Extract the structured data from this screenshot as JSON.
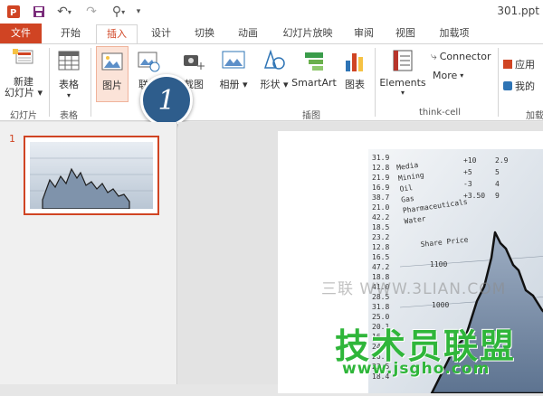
{
  "window": {
    "title": "301.ppt"
  },
  "tabs": [
    "文件",
    "开始",
    "插入",
    "设计",
    "切换",
    "动画",
    "幻灯片放映",
    "审阅",
    "视图",
    "加载项"
  ],
  "active_tab": "插入",
  "ribbon": {
    "new_slide": "新建\n幻灯片",
    "table": "表格",
    "picture": "图片",
    "online": "联机",
    "screenshot": "截图",
    "album": "相册",
    "shapes": "形状",
    "smartart": "SmartArt",
    "chart": "图表",
    "elements": "Elements",
    "connector": "Connector",
    "more": "More",
    "apps": "应用",
    "my_apps": "我的",
    "groups": {
      "slides": "幻灯片",
      "tables": "表格",
      "images": "插图",
      "thinkcell": "think-cell",
      "addins": "加载"
    }
  },
  "thumbnails": {
    "number": "1"
  },
  "callout": "1",
  "slide_image": {
    "rows": [
      "Media",
      "Mining",
      "Oil",
      "Gas",
      "Pharmaceuticals",
      "Water"
    ],
    "title": "Share Price",
    "label1100": "1100",
    "label1000": "1000",
    "col1": [
      "31.9",
      "12.8",
      "21.9",
      "16.9",
      "38.7",
      "21.0",
      "42.2",
      "18.5",
      "23.2",
      "12.8",
      "16.5",
      "47.2",
      "18.8",
      "41.0",
      "28.5",
      "31.8",
      "25.0",
      "20.1",
      "16.3",
      "24.7",
      "26.3",
      "23.5",
      "18.4"
    ]
  },
  "watermark": {
    "top": "三联 WWW.3LIAN.COM",
    "main": "技术员联盟",
    "url": "www.jsgho.com"
  }
}
